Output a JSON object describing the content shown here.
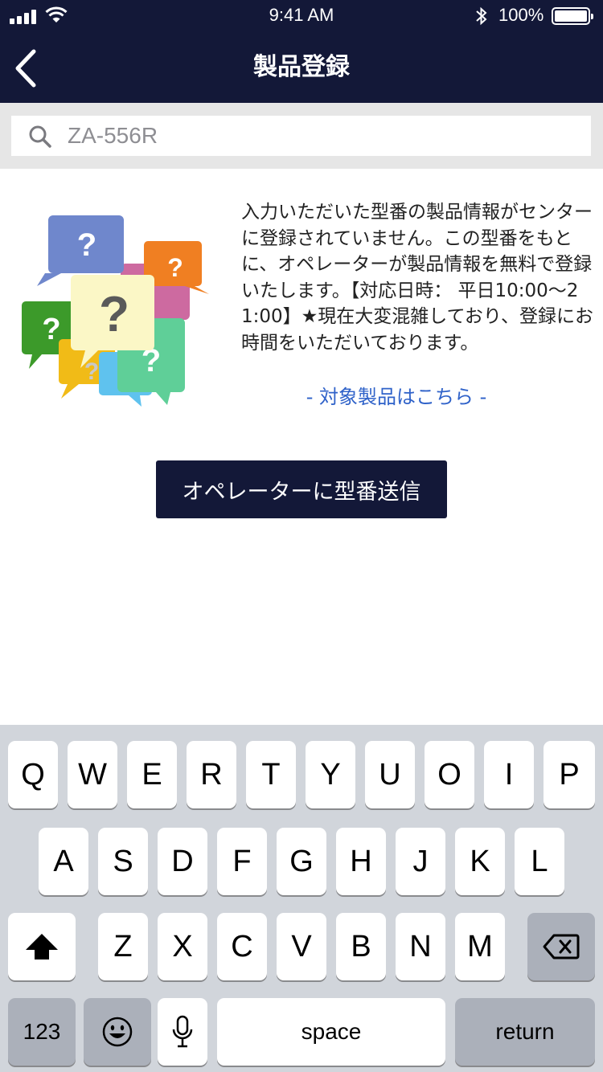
{
  "status_bar": {
    "time": "9:41 AM",
    "battery": "100%"
  },
  "nav": {
    "title": "製品登録"
  },
  "search": {
    "value": "ZA-556R"
  },
  "message": "入力いただいた型番の製品情報がセンターに登録されていません。この型番をもとに、オペレーターが製品情報を無料で登録いたします。【対応日時： 平日10:00〜21:00】★現在大変混雑しており、登録にお時間をいただいております。",
  "link_text": "- 対象製品はこちら -",
  "send_button": "オペレーターに型番送信",
  "keyboard": {
    "row1": [
      "Q",
      "W",
      "E",
      "R",
      "T",
      "Y",
      "U",
      "O",
      "I",
      "P"
    ],
    "row2": [
      "A",
      "S",
      "D",
      "F",
      "G",
      "H",
      "J",
      "K",
      "L"
    ],
    "row3": [
      "Z",
      "X",
      "C",
      "V",
      "B",
      "N",
      "M"
    ],
    "numbers_label": "123",
    "space_label": "space",
    "return_label": "return"
  },
  "colors": {
    "navbar": "#131838",
    "link": "#2f62c9",
    "keyboard_bg": "#d1d5db"
  }
}
